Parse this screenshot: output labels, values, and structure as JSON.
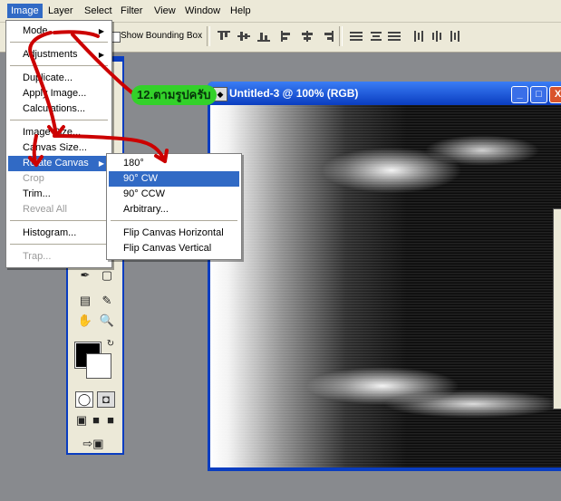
{
  "menubar": [
    "Image",
    "Layer",
    "Select",
    "Filter",
    "View",
    "Window",
    "Help"
  ],
  "options_bar": {
    "show_bounding_box": "Show Bounding Box",
    "checked": false
  },
  "document": {
    "title": "Untitled-3 @ 100% (RGB)",
    "icon": "ps-doc-icon",
    "controls": [
      "_",
      "□",
      "X"
    ]
  },
  "image_menu": {
    "items": [
      {
        "label": "Mode",
        "submenu": true,
        "disabled": false
      },
      {
        "label": "Adjustments",
        "submenu": true,
        "disabled": false
      },
      {
        "label": "Duplicate...",
        "submenu": false,
        "disabled": false
      },
      {
        "label": "Apply Image...",
        "submenu": false,
        "disabled": false
      },
      {
        "label": "Calculations...",
        "submenu": false,
        "disabled": false
      },
      {
        "label": "Image Size...",
        "submenu": false,
        "disabled": false
      },
      {
        "label": "Canvas Size...",
        "submenu": false,
        "disabled": false
      },
      {
        "label": "Rotate Canvas",
        "submenu": true,
        "disabled": false,
        "highlighted": true
      },
      {
        "label": "Crop",
        "submenu": false,
        "disabled": true
      },
      {
        "label": "Trim...",
        "submenu": false,
        "disabled": false
      },
      {
        "label": "Reveal All",
        "submenu": false,
        "disabled": true
      },
      {
        "label": "Histogram...",
        "submenu": false,
        "disabled": false
      },
      {
        "label": "Trap...",
        "submenu": false,
        "disabled": true
      }
    ]
  },
  "rotate_menu": {
    "items": [
      {
        "label": "180°",
        "highlighted": false
      },
      {
        "label": "90° CW",
        "highlighted": true
      },
      {
        "label": "90° CCW",
        "highlighted": false
      },
      {
        "label": "Arbitrary...",
        "highlighted": false
      },
      {
        "label": "Flip Canvas Horizontal",
        "highlighted": false
      },
      {
        "label": "Flip Canvas Vertical",
        "highlighted": false
      }
    ]
  },
  "annotation": {
    "text": "12.ตามรูปครับ"
  },
  "colors": {
    "menu_highlight": "#316ac5",
    "window_frame": "#0a3dc0",
    "annotation_bg": "#33d12a",
    "arrow": "#cc0000",
    "workspace": "#888a8e"
  }
}
